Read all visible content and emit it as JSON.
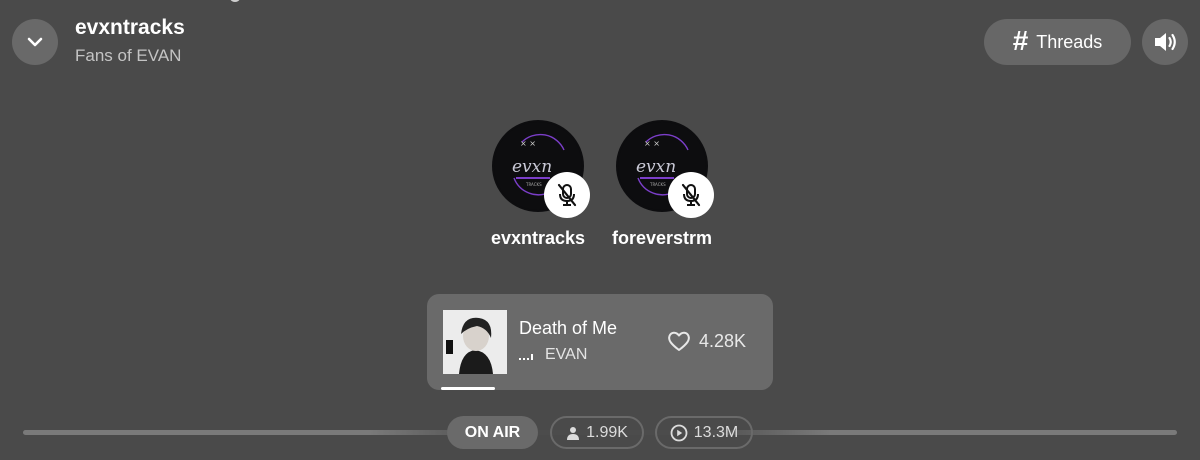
{
  "header": {
    "title": "evxntracks",
    "subtitle": "Fans of EVAN",
    "threads_label": "Threads"
  },
  "speakers": [
    {
      "name": "evxntracks",
      "muted": true
    },
    {
      "name": "foreverstrm",
      "muted": true
    }
  ],
  "now_playing": {
    "title": "Death of Me",
    "artist": "EVAN",
    "likes": "4.28K"
  },
  "status": {
    "on_air": "ON AIR",
    "listeners": "1.99K",
    "plays": "13.3M"
  },
  "icons": {
    "collapse": "chevron-down-icon",
    "threads": "hash-icon",
    "sound": "speaker-icon",
    "mute": "mic-off-icon",
    "like": "heart-icon",
    "listeners": "person-icon",
    "plays": "play-circle-icon",
    "equalizer": "equalizer-icon"
  }
}
